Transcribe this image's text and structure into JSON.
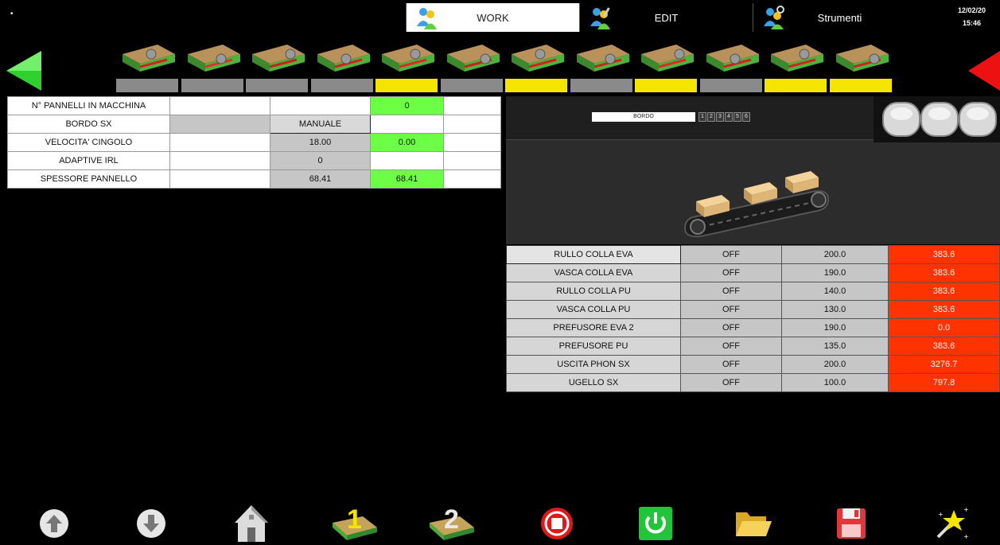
{
  "topbar": {
    "dot": "•",
    "tabs": [
      {
        "label": "WORK",
        "icon": "users-icon"
      },
      {
        "label": "EDIT",
        "icon": "users-edit-icon"
      },
      {
        "label": "Strumenti",
        "icon": "users-tools-icon"
      }
    ],
    "date": "12/02/20",
    "time": "15:46"
  },
  "units": {
    "bars": [
      "gray",
      "gray",
      "gray",
      "gray",
      "yellow",
      "gray",
      "yellow",
      "gray",
      "yellow",
      "gray",
      "yellow",
      "yellow"
    ],
    "icons": [
      "saw-unit-icon",
      "roller-unit-icon",
      "trimmer-unit-icon",
      "cutter-unit-icon",
      "scraper-unit-icon",
      "gear-unit-icon",
      "tool-unit-icon",
      "grinder-unit-icon",
      "spray-unit-icon",
      "corner-unit-icon",
      "brush-unit-icon",
      "polish-unit-icon"
    ],
    "colors": {
      "gray": "#8a8a8a",
      "yellow": "#f5e400",
      "nav_left": "#2fd12f",
      "nav_right": "#ee1111"
    }
  },
  "params": {
    "rows": [
      {
        "label": "N° PANNELLI IN MACCHINA",
        "c1": "",
        "c2": "",
        "c3": "0",
        "c4": ""
      },
      {
        "label": "BORDO SX",
        "c1": "",
        "c2": "MANUALE",
        "c3": "",
        "c4": ""
      },
      {
        "label": "VELOCITA' CINGOLO",
        "c1": "",
        "c2": "18.00",
        "c3": "0.00",
        "c4": ""
      },
      {
        "label": "ADAPTIVE IRL",
        "c1": "",
        "c2": "0",
        "c3": "",
        "c4": ""
      },
      {
        "label": "SPESSORE PANNELLO",
        "c1": "",
        "c2": "68.41",
        "c3": "68.41",
        "c4": ""
      }
    ]
  },
  "bordo": {
    "label": "BORDO",
    "numbers": [
      "1",
      "2",
      "3",
      "4",
      "5",
      "6"
    ]
  },
  "temps": {
    "rows": [
      {
        "name": "RULLO COLLA EVA",
        "status": "OFF",
        "set": "200.0",
        "actual": "383.6"
      },
      {
        "name": "VASCA COLLA EVA",
        "status": "OFF",
        "set": "190.0",
        "actual": "383.6"
      },
      {
        "name": "RULLO COLLA PU",
        "status": "OFF",
        "set": "140.0",
        "actual": "383.6"
      },
      {
        "name": "VASCA COLLA PU",
        "status": "OFF",
        "set": "130.0",
        "actual": "383.6"
      },
      {
        "name": "PREFUSORE EVA 2",
        "status": "OFF",
        "set": "190.0",
        "actual": "0.0"
      },
      {
        "name": "PREFUSORE PU",
        "status": "OFF",
        "set": "135.0",
        "actual": "383.6"
      },
      {
        "name": "USCITA PHON SX",
        "status": "OFF",
        "set": "200.0",
        "actual": "3276.7"
      },
      {
        "name": "UGELLO SX",
        "status": "OFF",
        "set": "100.0",
        "actual": "797.8"
      }
    ],
    "colors": {
      "alarm": "#ff3300"
    }
  },
  "toolbar": {
    "icons": [
      "arrow-up-icon",
      "arrow-down-icon",
      "home-icon",
      "panel-1-icon",
      "panel-2-icon",
      "stop-icon",
      "power-icon",
      "folder-icon",
      "save-icon",
      "magic-wand-icon"
    ],
    "panel1_label": "1",
    "panel2_label": "2"
  }
}
